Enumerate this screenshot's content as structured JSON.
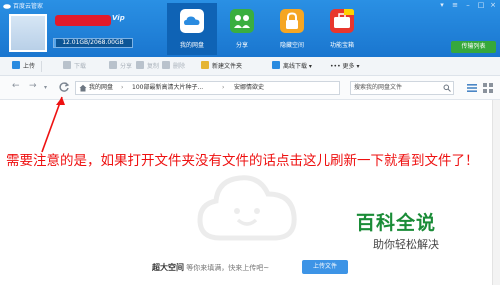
{
  "app": {
    "title": "百度云管家"
  },
  "user": {
    "storage_text": "12.01GB/2068.00GB",
    "storage_fraction": 0.006,
    "vip_label": "Vip"
  },
  "nav_tabs": [
    {
      "label": "我的网盘",
      "active": true,
      "color": "#ffffff"
    },
    {
      "label": "分享",
      "active": false,
      "color": "#3aae3f"
    },
    {
      "label": "隐藏空间",
      "active": false,
      "color": "#f5a623"
    },
    {
      "label": "功能宝箱",
      "active": false,
      "color": "#e8362d"
    }
  ],
  "upload_list_label": "传输列表",
  "toolbar": [
    {
      "label": "上传",
      "disabled": false,
      "color": "#2a8be0"
    },
    {
      "label": "下载",
      "disabled": true,
      "color": "#9aa5b1"
    },
    {
      "label": "分享",
      "disabled": true,
      "color": "#9aa5b1"
    },
    {
      "label": "复制",
      "disabled": true,
      "color": "#9aa5b1"
    },
    {
      "label": "删除",
      "disabled": true,
      "color": "#9aa5b1"
    },
    {
      "label": "新建文件夹",
      "disabled": false,
      "color": "#e5b534"
    },
    {
      "label": "离线下载",
      "disabled": false,
      "color": "#2a8be0"
    },
    {
      "label": "更多",
      "disabled": false,
      "color": "#6f7b88"
    }
  ],
  "breadcrumb": {
    "root": "我的网盘",
    "folder1": "100部最新高清大片种子...",
    "folder2": "安娜情欲史"
  },
  "search": {
    "placeholder": "搜索我的网盘文件"
  },
  "annotation": "需要注意的是，如果打开文件夹没有文件的话点击这儿刷新一下就看到文件了！",
  "empty_state": {
    "bold": "超大空间",
    "text": "等你来填满，快来上传吧~",
    "button_label": "上传文件"
  },
  "watermark": {
    "title": "百科全说",
    "subtitle": "助你轻松解决"
  },
  "colors": {
    "header": "#1f82d8",
    "annotation": "#ee1111",
    "watermark": "#1a8c37"
  }
}
